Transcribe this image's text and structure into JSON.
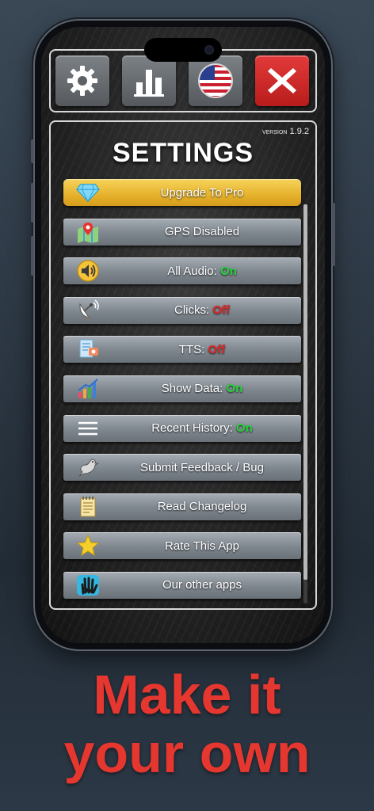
{
  "version_prefix": "VERSION",
  "version_number": "1.9.2",
  "title": "SETTINGS",
  "top_buttons": [
    {
      "icon": "gear-icon"
    },
    {
      "icon": "bar-chart-icon"
    },
    {
      "icon": "us-flag-icon"
    },
    {
      "icon": "close-icon"
    }
  ],
  "items": [
    {
      "label": "Upgrade To Pro",
      "state": "",
      "icon": "diamond-icon"
    },
    {
      "label": "GPS Disabled",
      "state": "",
      "icon": "map-pin-icon"
    },
    {
      "label": "All Audio: ",
      "state": "On",
      "icon": "speaker-icon"
    },
    {
      "label": "Clicks: ",
      "state": "Off",
      "icon": "satellite-dish-icon"
    },
    {
      "label": "TTS: ",
      "state": "Off",
      "icon": "document-speech-icon"
    },
    {
      "label": "Show Data: ",
      "state": "On",
      "icon": "growth-chart-icon"
    },
    {
      "label": "Recent History: ",
      "state": "On",
      "icon": "menu-lines-icon"
    },
    {
      "label": "Submit Feedback / Bug",
      "state": "",
      "icon": "bird-icon"
    },
    {
      "label": "Read Changelog",
      "state": "",
      "icon": "notepad-icon"
    },
    {
      "label": "Rate This App",
      "state": "",
      "icon": "star-icon"
    },
    {
      "label": "Our other apps",
      "state": "",
      "icon": "hand-icon"
    }
  ],
  "tagline_line1": "Make it",
  "tagline_line2": "your own",
  "colors": {
    "on": "#27d53c",
    "off": "#e32626",
    "accent": "#e5372f",
    "pro": "#e6b22c"
  }
}
